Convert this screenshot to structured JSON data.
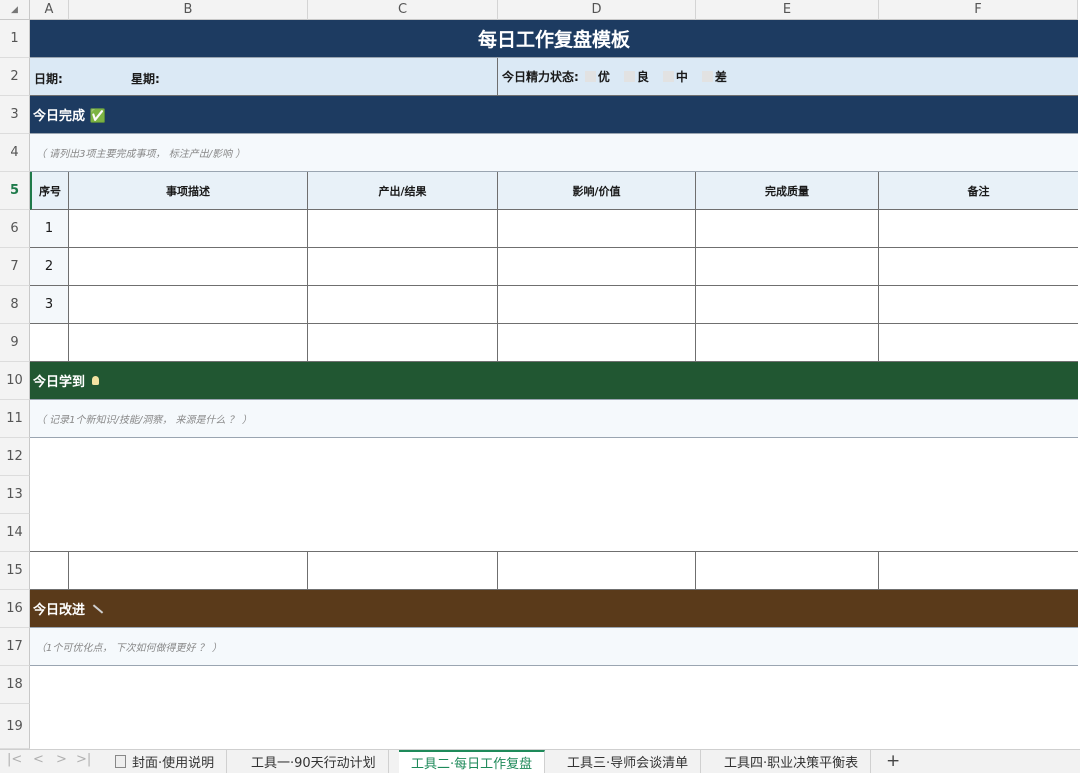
{
  "columns": [
    "A",
    "B",
    "C",
    "D",
    "E",
    "F"
  ],
  "corner_glyph": "◢",
  "rows": [
    "1",
    "2",
    "3",
    "4",
    "5",
    "6",
    "7",
    "8",
    "9",
    "10",
    "11",
    "12",
    "13",
    "14",
    "15",
    "16",
    "17",
    "18",
    "19"
  ],
  "title": "每日工作复盘模板",
  "row2": {
    "date_label": "日期:",
    "weekday_label": "星期:",
    "energy_label": "今日精力状态:",
    "options": [
      "优",
      "良",
      "中",
      "差"
    ]
  },
  "section_done": {
    "title": "今日完成 ✅",
    "hint": "（ 请列出3项主要完成事项， 标注产出/影响 ）",
    "color": "#1d3b61"
  },
  "table_headers": [
    "序号",
    "事项描述",
    "产出/结果",
    "影响/价值",
    "完成质量",
    "备注"
  ],
  "item_numbers": [
    "1",
    "2",
    "3"
  ],
  "section_learn": {
    "title": "今日学到",
    "icon": "lightbulb-icon",
    "hint": "（ 记录1个新知识/技能/洞察， 来源是什么 ？ ）",
    "color": "#215732"
  },
  "section_improve": {
    "title": "今日改进",
    "icon": "wrench-icon",
    "hint": "（1个可优化点， 下次如何做得更好 ？ ）",
    "color": "#5a3a1a"
  },
  "sheet_tabs": [
    "封面·使用说明",
    "工具一·90天行动计划",
    "工具二·每日工作复盘",
    "工具三·导师会谈清单",
    "工具四·职业决策平衡表"
  ],
  "active_tab": "工具二·每日工作复盘",
  "nav_glyphs": [
    "|<",
    "<",
    ">",
    ">|"
  ],
  "add_sheet": "+"
}
